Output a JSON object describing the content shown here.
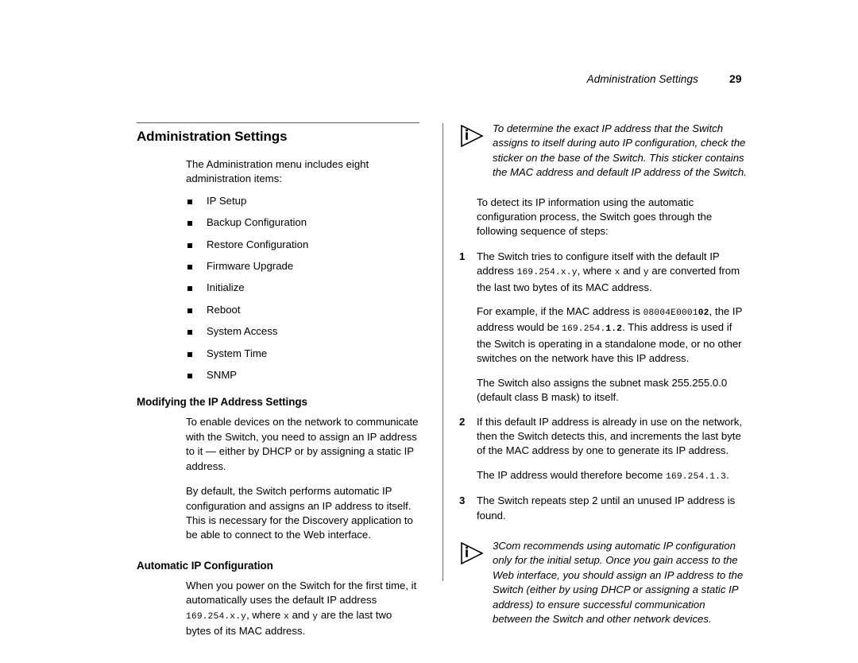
{
  "header": {
    "chapter_title": "Administration Settings",
    "page_number": "29"
  },
  "left_column": {
    "section_title": "Administration Settings",
    "intro": "The Administration menu includes eight administration items:",
    "menu_items": [
      "IP Setup",
      "Backup Configuration",
      "Restore Configuration",
      "Firmware Upgrade",
      "Initialize",
      "Reboot",
      "System Access",
      "System Time",
      "SNMP"
    ],
    "modifying": {
      "heading": "Modifying the IP Address Settings",
      "para1": "To enable devices on the network to communicate with the Switch, you need to assign an IP address to it — either by DHCP or by assigning a static IP address.",
      "para2": "By default, the Switch performs automatic IP configuration and assigns an IP address to itself. This is necessary for the Discovery application to be able to connect to the Web interface."
    },
    "automatic": {
      "heading": "Automatic IP Configuration",
      "para_before": "When you power on the Switch for the first time, it automatically uses the default IP address ",
      "mono_address": "169.254.x.y",
      "para_mid1": ", where ",
      "mono_x": "x",
      "para_mid2": " and ",
      "mono_y": "y",
      "para_after": " are the last two bytes of its MAC address."
    }
  },
  "right_column": {
    "note_1": {
      "icon": "info-note-icon",
      "text": "To determine the exact IP address that the Switch assigns to itself during auto IP configuration, check the sticker on the base of the Switch. This sticker contains the MAC address and default IP address of the Switch."
    },
    "intro": "To detect its IP information using the automatic configuration process, the Switch goes through the following sequence of steps:",
    "step_1": {
      "number": "1",
      "text_before": "The Switch tries to configure itself with the default IP address ",
      "mono_address": "169.254.x.y",
      "text_mid1": ", where ",
      "mono_x": "x",
      "text_mid2": " and ",
      "mono_y": "y",
      "text_after": " are converted from the last two bytes of its MAC address."
    },
    "step_1_example": {
      "text_before": "For example, if the MAC address is ",
      "mac_plain": "08004E0001",
      "mac_bold": "02",
      "text_mid": ", the IP address would be ",
      "ip_plain": "169.254.",
      "ip_bold": "1.2",
      "text_after": ". This address is used if the Switch is operating in a standalone mode, or no other switches on the network have this IP address."
    },
    "step_1_subnet": "The Switch also assigns the subnet mask 255.255.0.0 (default class B mask) to itself.",
    "step_2": {
      "number": "2",
      "text": "If this default IP address is already in use on the network, then the Switch detects this, and increments the last byte of the MAC address by one to generate its IP address."
    },
    "step_2_result": {
      "text_before": "The IP address would therefore become ",
      "mono_address": "169.254.1.3",
      "text_after": "."
    },
    "step_3": {
      "number": "3",
      "text": "The Switch repeats step 2 until an unused IP address is found."
    },
    "note_2": {
      "icon": "info-note-icon",
      "text": "3Com recommends using automatic IP configuration only for the initial setup. Once you gain access to the Web interface, you should assign an IP address to the Switch (either by using DHCP or assigning a static IP address) to ensure successful communication between the Switch and other network devices."
    }
  },
  "colors": {
    "text": "#000000",
    "rule": "#5a5a5a",
    "background": "#ffffff"
  }
}
